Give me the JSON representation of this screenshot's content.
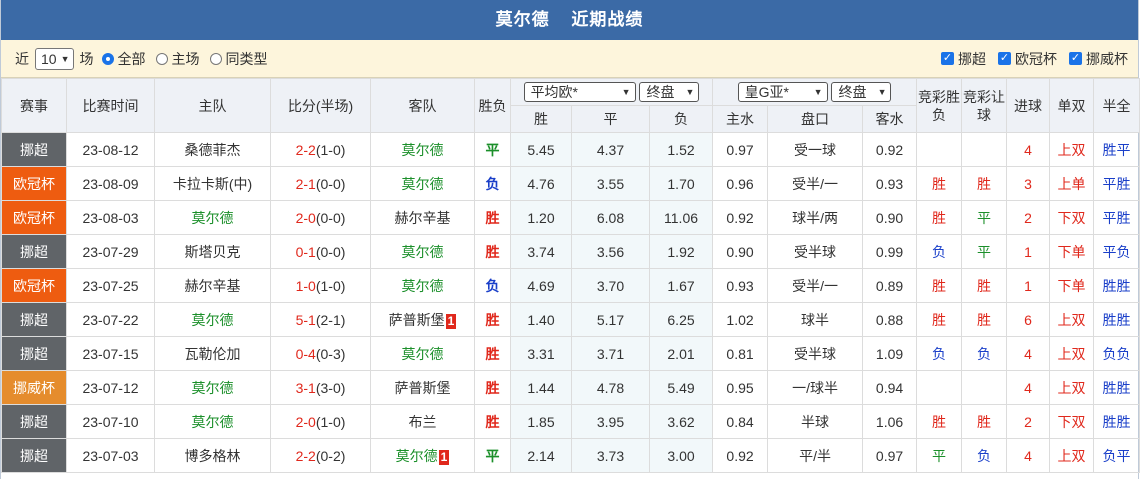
{
  "title": {
    "team": "莫尔德",
    "subtitle": "近期战绩"
  },
  "filter": {
    "prefix": "近",
    "count": "10",
    "suffix": "场",
    "radios": [
      {
        "label": "全部",
        "checked": true
      },
      {
        "label": "主场",
        "checked": false
      },
      {
        "label": "同类型",
        "checked": false
      }
    ],
    "leagues": [
      "挪超",
      "欧冠杯",
      "挪威杯"
    ]
  },
  "headers": {
    "league": "赛事",
    "time": "比赛时间",
    "home": "主队",
    "score": "比分(半场)",
    "away": "客队",
    "result": "胜负",
    "euro_company": "平均欧*",
    "euro_type": "终盘",
    "asia_company": "皇G亚*",
    "asia_type": "终盘",
    "lottery_wdl": "竞彩胜负",
    "lottery_hcp": "竞彩让球",
    "goals": "进球",
    "oe": "单双",
    "half_full": "半全",
    "euro_cols": [
      "胜",
      "平",
      "负"
    ],
    "asia_cols": [
      "主水",
      "盘口",
      "客水"
    ]
  },
  "colors": {
    "header_bar": "#3b6aa6",
    "filter_bg": "#fdf5dc",
    "win": "#e0281c",
    "loss": "#1a3fc9",
    "draw": "#1b8f2a"
  },
  "rows": [
    {
      "league": "挪超",
      "lg": "nuo",
      "date": "23-08-12",
      "home": "桑德菲杰",
      "home_is": false,
      "ft": "2-2",
      "ht": "(1-0)",
      "away": "莫尔德",
      "away_is": true,
      "away_card": "",
      "home_card": "",
      "res": "平",
      "w": "5.45",
      "d": "4.37",
      "l": "1.52",
      "hw": "0.97",
      "line": "受一球",
      "aw": "0.92",
      "jc1": "",
      "jc2": "",
      "goals": "4",
      "oe": "上双",
      "hf": "胜平"
    },
    {
      "league": "欧冠杯",
      "lg": "ouguan",
      "date": "23-08-09",
      "home": "卡拉卡斯(中)",
      "home_is": false,
      "ft": "2-1",
      "ht": "(0-0)",
      "away": "莫尔德",
      "away_is": true,
      "away_card": "",
      "home_card": "",
      "res": "负",
      "w": "4.76",
      "d": "3.55",
      "l": "1.70",
      "hw": "0.96",
      "line": "受半/一",
      "aw": "0.93",
      "jc1": "胜",
      "jc2": "胜",
      "goals": "3",
      "oe": "上单",
      "hf": "平胜"
    },
    {
      "league": "欧冠杯",
      "lg": "ouguan",
      "date": "23-08-03",
      "home": "莫尔德",
      "home_is": true,
      "ft": "2-0",
      "ht": "(0-0)",
      "away": "赫尔辛基",
      "away_is": false,
      "away_card": "",
      "home_card": "",
      "res": "胜",
      "w": "1.20",
      "d": "6.08",
      "l": "11.06",
      "hw": "0.92",
      "line": "球半/两",
      "aw": "0.90",
      "jc1": "胜",
      "jc2": "平",
      "goals": "2",
      "oe": "下双",
      "hf": "平胜"
    },
    {
      "league": "挪超",
      "lg": "nuo",
      "date": "23-07-29",
      "home": "斯塔贝克",
      "home_is": false,
      "ft": "0-1",
      "ht": "(0-0)",
      "away": "莫尔德",
      "away_is": true,
      "away_card": "",
      "home_card": "",
      "res": "胜",
      "w": "3.74",
      "d": "3.56",
      "l": "1.92",
      "hw": "0.90",
      "line": "受半球",
      "aw": "0.99",
      "jc1": "负",
      "jc2": "平",
      "goals": "1",
      "oe": "下单",
      "hf": "平负"
    },
    {
      "league": "欧冠杯",
      "lg": "ouguan",
      "date": "23-07-25",
      "home": "赫尔辛基",
      "home_is": false,
      "ft": "1-0",
      "ht": "(1-0)",
      "away": "莫尔德",
      "away_is": true,
      "away_card": "",
      "home_card": "",
      "res": "负",
      "w": "4.69",
      "d": "3.70",
      "l": "1.67",
      "hw": "0.93",
      "line": "受半/一",
      "aw": "0.89",
      "jc1": "胜",
      "jc2": "胜",
      "goals": "1",
      "oe": "下单",
      "hf": "胜胜"
    },
    {
      "league": "挪超",
      "lg": "nuo",
      "date": "23-07-22",
      "home": "莫尔德",
      "home_is": true,
      "ft": "5-1",
      "ht": "(2-1)",
      "away": "萨普斯堡",
      "away_is": false,
      "away_card": "1",
      "home_card": "",
      "res": "胜",
      "w": "1.40",
      "d": "5.17",
      "l": "6.25",
      "hw": "1.02",
      "line": "球半",
      "aw": "0.88",
      "jc1": "胜",
      "jc2": "胜",
      "goals": "6",
      "oe": "上双",
      "hf": "胜胜"
    },
    {
      "league": "挪超",
      "lg": "nuo",
      "date": "23-07-15",
      "home": "瓦勒伦加",
      "home_is": false,
      "ft": "0-4",
      "ht": "(0-3)",
      "away": "莫尔德",
      "away_is": true,
      "away_card": "",
      "home_card": "",
      "res": "胜",
      "w": "3.31",
      "d": "3.71",
      "l": "2.01",
      "hw": "0.81",
      "line": "受半球",
      "aw": "1.09",
      "jc1": "负",
      "jc2": "负",
      "goals": "4",
      "oe": "上双",
      "hf": "负负"
    },
    {
      "league": "挪威杯",
      "lg": "cup",
      "date": "23-07-12",
      "home": "莫尔德",
      "home_is": true,
      "ft": "3-1",
      "ht": "(3-0)",
      "away": "萨普斯堡",
      "away_is": false,
      "away_card": "",
      "home_card": "",
      "res": "胜",
      "w": "1.44",
      "d": "4.78",
      "l": "5.49",
      "hw": "0.95",
      "line": "一/球半",
      "aw": "0.94",
      "jc1": "",
      "jc2": "",
      "goals": "4",
      "oe": "上双",
      "hf": "胜胜"
    },
    {
      "league": "挪超",
      "lg": "nuo",
      "date": "23-07-10",
      "home": "莫尔德",
      "home_is": true,
      "ft": "2-0",
      "ht": "(1-0)",
      "away": "布兰",
      "away_is": false,
      "away_card": "",
      "home_card": "",
      "res": "胜",
      "w": "1.85",
      "d": "3.95",
      "l": "3.62",
      "hw": "0.84",
      "line": "半球",
      "aw": "1.06",
      "jc1": "胜",
      "jc2": "胜",
      "goals": "2",
      "oe": "下双",
      "hf": "胜胜"
    },
    {
      "league": "挪超",
      "lg": "nuo",
      "date": "23-07-03",
      "home": "博多格林",
      "home_is": false,
      "ft": "2-2",
      "ht": "(0-2)",
      "away": "莫尔德",
      "away_is": true,
      "away_card": "1",
      "home_card": "",
      "res": "平",
      "w": "2.14",
      "d": "3.73",
      "l": "3.00",
      "hw": "0.92",
      "line": "平/半",
      "aw": "0.97",
      "jc1": "平",
      "jc2": "负",
      "goals": "4",
      "oe": "上双",
      "hf": "负平"
    }
  ]
}
